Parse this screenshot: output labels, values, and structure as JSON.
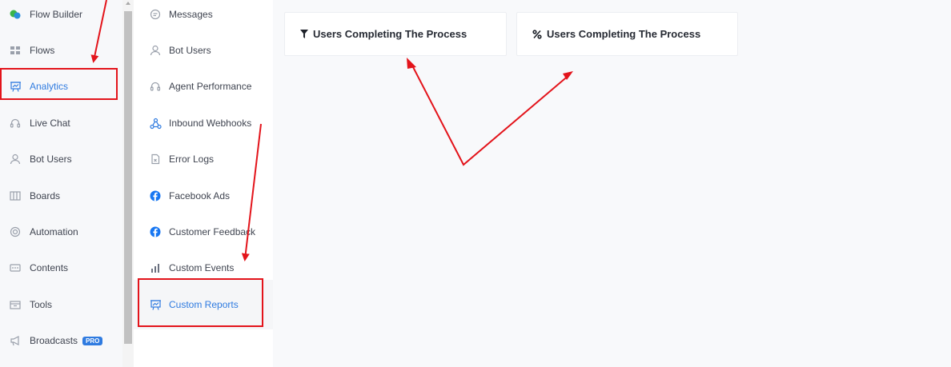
{
  "sidebar": {
    "items": [
      {
        "label": "Flow Builder",
        "icon": "flow-builder-icon"
      },
      {
        "label": "Flows",
        "icon": "grid-icon"
      },
      {
        "label": "Analytics",
        "icon": "presentation-icon",
        "active": true
      },
      {
        "label": "Live Chat",
        "icon": "headset-icon"
      },
      {
        "label": "Bot Users",
        "icon": "user-icon"
      },
      {
        "label": "Boards",
        "icon": "board-icon"
      },
      {
        "label": "Automation",
        "icon": "automation-icon"
      },
      {
        "label": "Contents",
        "icon": "contents-icon"
      },
      {
        "label": "Tools",
        "icon": "tools-icon"
      },
      {
        "label": "Broadcasts",
        "icon": "megaphone-icon",
        "badge": "PRO"
      }
    ]
  },
  "submenu": {
    "items": [
      {
        "label": "Messages",
        "icon": "chat-bubble-icon"
      },
      {
        "label": "Bot Users",
        "icon": "user-icon"
      },
      {
        "label": "Agent Performance",
        "icon": "headset-icon"
      },
      {
        "label": "Inbound Webhooks",
        "icon": "webhook-icon"
      },
      {
        "label": "Error Logs",
        "icon": "file-x-icon"
      },
      {
        "label": "Facebook Ads",
        "icon": "facebook-icon"
      },
      {
        "label": "Customer Feedback",
        "icon": "facebook-icon"
      },
      {
        "label": "Custom Events",
        "icon": "bar-chart-icon"
      },
      {
        "label": "Custom Reports",
        "icon": "presentation-icon",
        "active": true
      }
    ]
  },
  "reports": [
    {
      "title": "Users Completing The Process",
      "icon": "funnel-icon"
    },
    {
      "title": "Users Completing The Process",
      "icon": "percent-icon"
    }
  ],
  "colors": {
    "accent": "#2f7be0",
    "annotation": "#e3141b"
  }
}
